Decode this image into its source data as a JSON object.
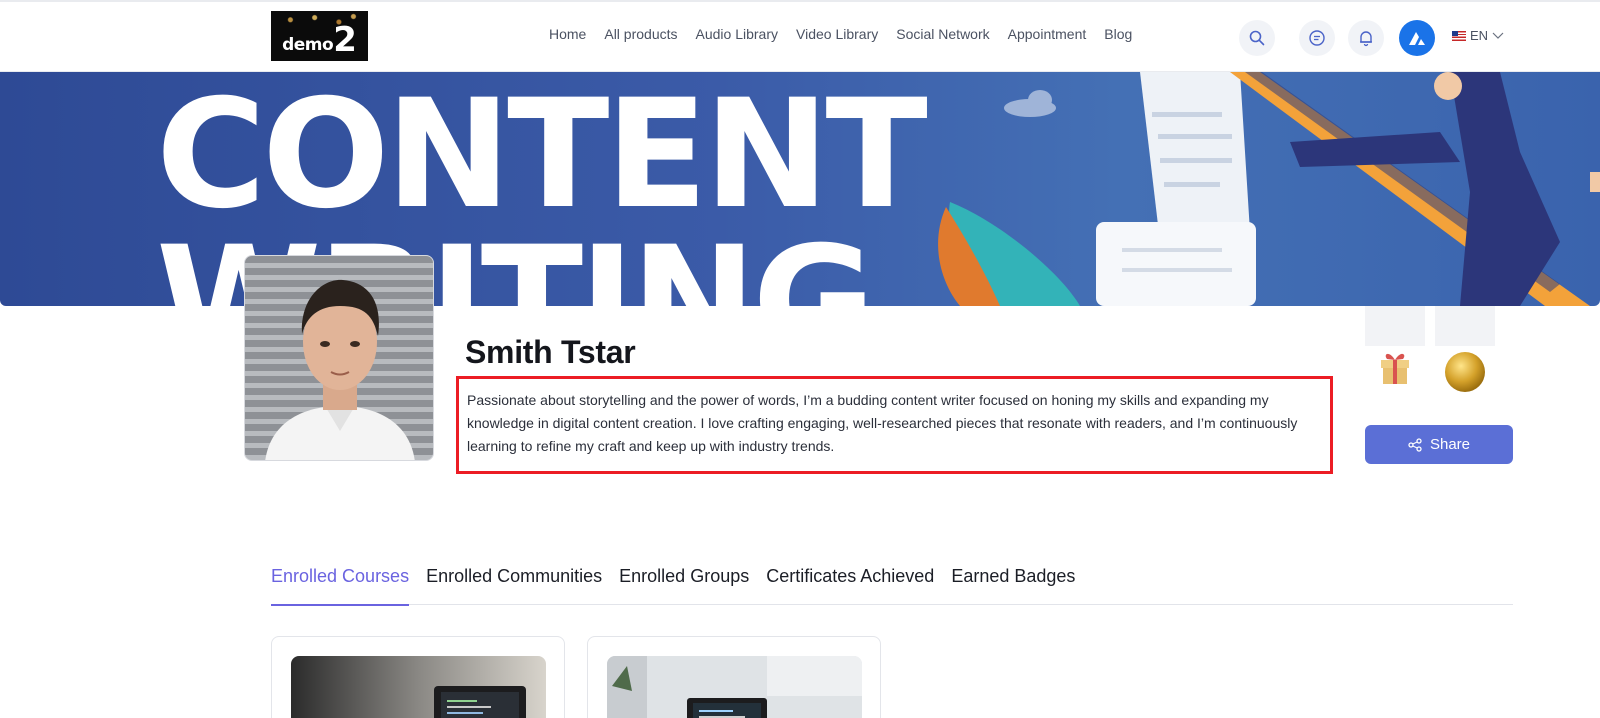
{
  "header": {
    "logo": {
      "word": "demo",
      "number": "2"
    },
    "nav": [
      "Home",
      "All products",
      "Audio Library",
      "Video Library",
      "Social Network",
      "Appointment",
      "Blog"
    ],
    "language": "EN",
    "icons": [
      "search-icon",
      "chat-icon",
      "bell-icon",
      "user-avatar-icon",
      "chevron-down-icon"
    ]
  },
  "banner": {
    "line1": "CONTENT",
    "line2": "WRITING"
  },
  "profile": {
    "name": "Smith Tstar",
    "bio": "Passionate about storytelling and the power of words, I’m a budding content writer focused on honing my skills and expanding my knowledge in digital content creation. I love crafting engaging, well-researched pieces that resonate with readers, and I’m continuously learning to refine my craft and keep up with industry trends.",
    "badges": [
      "gift-badge-icon",
      "gold-coin-badge-icon"
    ],
    "share_label": "Share"
  },
  "tabs": [
    {
      "label": "Enrolled Courses",
      "active": true
    },
    {
      "label": "Enrolled Communities",
      "active": false
    },
    {
      "label": "Enrolled Groups",
      "active": false
    },
    {
      "label": "Certificates Achieved",
      "active": false
    },
    {
      "label": "Earned Badges",
      "active": false
    }
  ],
  "colors": {
    "accent": "#6a63e0",
    "share_button": "#5b6fd6",
    "highlight_border": "#ec1c24",
    "banner_blue": "#3b5ba8"
  }
}
